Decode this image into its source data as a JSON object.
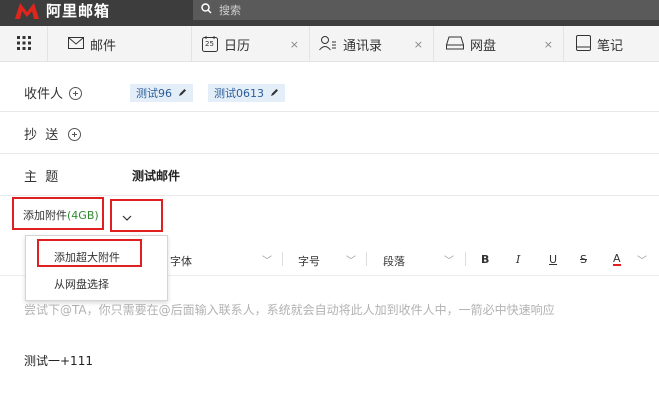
{
  "app": {
    "name": "阿里邮箱"
  },
  "search": {
    "placeholder": "搜索"
  },
  "tabs": [
    {
      "label": "邮件",
      "icon": "mail-icon"
    },
    {
      "label": "日历",
      "icon": "calendar-icon",
      "badge": "25",
      "close": "×"
    },
    {
      "label": "通讯录",
      "icon": "contacts-icon",
      "close": "×"
    },
    {
      "label": "网盘",
      "icon": "cloud-drive-icon",
      "close": "×"
    },
    {
      "label": "笔记",
      "icon": "notes-icon"
    }
  ],
  "compose": {
    "to_label": "收件人",
    "recipients": [
      "测试96",
      "测试0613"
    ],
    "cc_label": "抄  送",
    "subject_label": "主  题",
    "subject_value": "测试邮件",
    "attach_label": "添加附件",
    "attach_size": "(4GB)",
    "attach_dropdown_icon": "chevron-down-icon"
  },
  "dropdown": {
    "items": [
      "添加超大附件",
      "从网盘选择"
    ]
  },
  "toolbar": {
    "font_label": "字体",
    "size_label": "字号",
    "para_label": "段落",
    "bold": "B",
    "italic": "I",
    "underline": "U",
    "strike": "S",
    "color": "A"
  },
  "editor": {
    "hint": "尝试下@TA，你只需要在@后面输入联系人，系统就会自动将此人加到收件人中，一箭必中快速响应",
    "body_text": "测试一+111"
  },
  "colors": {
    "topbar": "#3d3d3d",
    "logo_red": "#e0261c",
    "highlight_red": "#e02020",
    "chip_bg": "#e4eef8",
    "attach_size_green": "#2e8b2e"
  }
}
